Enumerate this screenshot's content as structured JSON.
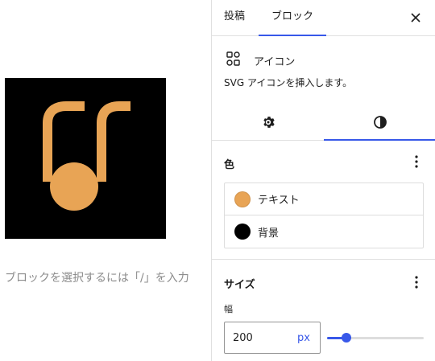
{
  "canvas": {
    "placeholder": "ブロックを選択するには「/」を入力"
  },
  "sidebar": {
    "tabs": [
      {
        "label": "投稿"
      },
      {
        "label": "ブロック"
      }
    ],
    "close_icon": "close-icon",
    "block": {
      "icon": "grid-shapes-icon",
      "title": "アイコン",
      "description": "SVG アイコンを挿入します。"
    },
    "subtabs": [
      {
        "icon": "gear-icon"
      },
      {
        "icon": "contrast-icon"
      }
    ],
    "color_section": {
      "title": "色",
      "items": [
        {
          "label": "テキスト",
          "color": "#e8a455"
        },
        {
          "label": "背景",
          "color": "#000000"
        }
      ]
    },
    "size_section": {
      "title": "サイズ",
      "width_label": "幅",
      "width_value": "200",
      "width_unit": "px",
      "slider_fraction": 0.2
    }
  },
  "colors": {
    "accent": "#3858e9",
    "icon_fill": "#e8a455",
    "icon_background": "#000000"
  }
}
